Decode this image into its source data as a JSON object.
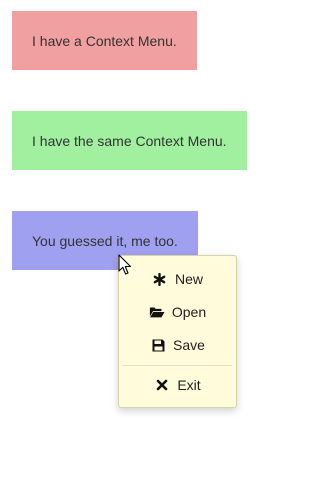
{
  "boxes": [
    {
      "text": "I have a Context Menu.",
      "color": "#f0a0a0"
    },
    {
      "text": "I have the same Context Menu.",
      "color": "#a0f0a0"
    },
    {
      "text": "You guessed it, me too.",
      "color": "#a0a0f0"
    }
  ],
  "context_menu": {
    "background": "#fffbdb",
    "items": [
      {
        "label": "New",
        "icon": "asterisk-icon"
      },
      {
        "label": "Open",
        "icon": "folder-open-icon"
      },
      {
        "label": "Save",
        "icon": "floppy-disk-icon"
      },
      {
        "label": "Exit",
        "icon": "close-icon"
      }
    ]
  }
}
